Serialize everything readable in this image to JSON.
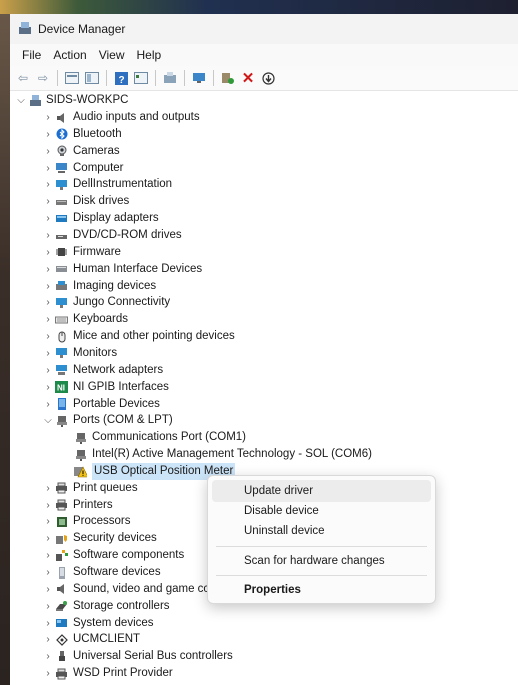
{
  "window": {
    "title": "Device Manager"
  },
  "menu": [
    "File",
    "Action",
    "View",
    "Help"
  ],
  "toolbar": [
    "back-icon",
    "forward-icon",
    "sep",
    "properties-icon",
    "view-icon",
    "sep",
    "help-icon",
    "details-icon",
    "sep",
    "scan-icon",
    "sep",
    "monitor-icon",
    "sep",
    "enable-icon",
    "remove-icon",
    "download-icon"
  ],
  "tree": {
    "root": "SIDS-WORKPC",
    "items": [
      {
        "label": "Audio inputs and outputs",
        "icon": "speaker-icon"
      },
      {
        "label": "Bluetooth",
        "icon": "bluetooth-icon"
      },
      {
        "label": "Cameras",
        "icon": "camera-icon"
      },
      {
        "label": "Computer",
        "icon": "computer-icon"
      },
      {
        "label": "DellInstrumentation",
        "icon": "monitor-icon"
      },
      {
        "label": "Disk drives",
        "icon": "disk-icon"
      },
      {
        "label": "Display adapters",
        "icon": "display-icon"
      },
      {
        "label": "DVD/CD-ROM drives",
        "icon": "dvd-icon"
      },
      {
        "label": "Firmware",
        "icon": "chip-icon"
      },
      {
        "label": "Human Interface Devices",
        "icon": "hid-icon"
      },
      {
        "label": "Imaging devices",
        "icon": "imaging-icon"
      },
      {
        "label": "Jungo Connectivity",
        "icon": "monitor-icon"
      },
      {
        "label": "Keyboards",
        "icon": "keyboard-icon"
      },
      {
        "label": "Mice and other pointing devices",
        "icon": "mouse-icon"
      },
      {
        "label": "Monitors",
        "icon": "monitor-icon"
      },
      {
        "label": "Network adapters",
        "icon": "network-icon"
      },
      {
        "label": "NI GPIB Interfaces",
        "icon": "ni-icon"
      },
      {
        "label": "Portable Devices",
        "icon": "portable-icon"
      },
      {
        "label": "Ports (COM & LPT)",
        "icon": "port-icon",
        "expanded": true
      },
      {
        "label": "Communications Port (COM1)",
        "icon": "port-icon",
        "child": true
      },
      {
        "label": "Intel(R) Active Management Technology - SOL (COM6)",
        "icon": "port-icon",
        "child": true
      },
      {
        "label": "USB Optical Position Meter",
        "icon": "warning-icon",
        "child": true,
        "selected": true
      },
      {
        "label": "Print queues",
        "icon": "printer-icon"
      },
      {
        "label": "Printers",
        "icon": "printer-icon"
      },
      {
        "label": "Processors",
        "icon": "processor-icon"
      },
      {
        "label": "Security devices",
        "icon": "security-icon"
      },
      {
        "label": "Software components",
        "icon": "component-icon"
      },
      {
        "label": "Software devices",
        "icon": "software-icon"
      },
      {
        "label": "Sound, video and game cc",
        "icon": "speaker-icon"
      },
      {
        "label": "Storage controllers",
        "icon": "storage-icon"
      },
      {
        "label": "System devices",
        "icon": "system-icon"
      },
      {
        "label": "UCMCLIENT",
        "icon": "ucm-icon"
      },
      {
        "label": "Universal Serial Bus controllers",
        "icon": "usb-icon"
      },
      {
        "label": "WSD Print Provider",
        "icon": "printer-icon"
      }
    ]
  },
  "context_menu": {
    "update": "Update driver",
    "disable": "Disable device",
    "uninstall": "Uninstall device",
    "scan": "Scan for hardware changes",
    "properties": "Properties"
  }
}
